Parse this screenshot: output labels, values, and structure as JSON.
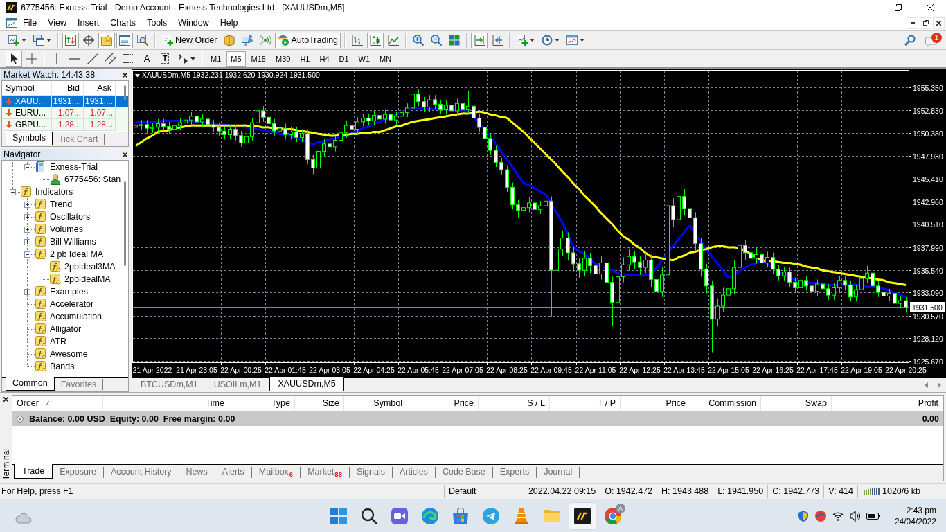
{
  "window": {
    "title": "6775456: Exness-Trial - Demo Account - Exness Technologies Ltd - [XAUUSDm,M5]"
  },
  "menu": [
    "File",
    "View",
    "Insert",
    "Charts",
    "Tools",
    "Window",
    "Help"
  ],
  "toolbar": [
    {
      "on": false
    },
    {
      "on": false
    },
    {
      "on": true
    },
    {
      "on": false
    },
    {
      "on": true
    },
    {
      "on": true
    },
    {
      "on": false
    },
    {
      "label": "New Order",
      "on": false
    },
    {
      "on": false
    },
    {
      "on": false
    },
    {
      "on": false
    },
    {
      "label": "AutoTrading",
      "on": true
    },
    {
      "on": false
    },
    {
      "on": true
    },
    {
      "on": false
    },
    {
      "on": false
    },
    {
      "on": false
    },
    {
      "on": false
    },
    {
      "on": true
    },
    {
      "on": false
    },
    {
      "on": false
    },
    {
      "on": false
    },
    {
      "on": false
    }
  ],
  "notifications": "1",
  "drawing_tools": [
    {
      "on": true
    },
    {
      "on": false
    },
    {
      "on": false
    },
    {
      "on": false
    },
    {
      "on": false
    },
    {
      "on": false
    },
    {
      "on": false
    },
    {
      "label": "A",
      "on": false
    },
    {
      "label": "T",
      "on": false
    },
    {
      "on": false
    }
  ],
  "periods": [
    {
      "label": "M1",
      "selected": false
    },
    {
      "label": "M5",
      "selected": true
    },
    {
      "label": "M15",
      "selected": false
    },
    {
      "label": "M30",
      "selected": false
    },
    {
      "label": "H1",
      "selected": false
    },
    {
      "label": "H4",
      "selected": false
    },
    {
      "label": "D1",
      "selected": false
    },
    {
      "label": "W1",
      "selected": false
    },
    {
      "label": "MN",
      "selected": false
    }
  ],
  "market_watch": {
    "title": "Market Watch: 14:43:38",
    "columns": [
      "Symbol",
      "Bid",
      "Ask"
    ],
    "rows": [
      {
        "symbol": "XAUU...",
        "bid": "1931....",
        "ask": "1931....",
        "down": true,
        "selected": true
      },
      {
        "symbol": "EURU...",
        "bid": "1.07...",
        "ask": "1.07...",
        "down": true,
        "selected": false
      },
      {
        "symbol": "GBPU...",
        "bid": "1.28...",
        "ask": "1.28...",
        "down": true,
        "selected": false
      }
    ],
    "tabs": [
      {
        "label": "Symbols",
        "selected": true
      },
      {
        "label": "Tick Chart",
        "selected": false
      }
    ]
  },
  "navigator": {
    "title": "Navigator",
    "tree": [
      {
        "children": [
          {
            "label": "Exness-Trial",
            "kind": "server",
            "expanded": true,
            "children": [
              {
                "label": "6775456: Stan",
                "kind": "account"
              }
            ]
          }
        ]
      },
      {
        "label": "Indicators",
        "kind": "function",
        "expanded": true,
        "children": [
          {
            "label": "Trend",
            "kind": "function",
            "expanded": false
          },
          {
            "label": "Oscillators",
            "kind": "function",
            "expanded": false
          },
          {
            "label": "Volumes",
            "kind": "function",
            "expanded": false
          },
          {
            "label": "Bill Williams",
            "kind": "function",
            "expanded": false
          },
          {
            "label": "2 pb Ideal MA",
            "kind": "custom",
            "expanded": true,
            "children": [
              {
                "label": "2pbIdeal3MA",
                "kind": "custom"
              },
              {
                "label": "2pbIdealMA",
                "kind": "custom"
              }
            ]
          },
          {
            "label": "Examples",
            "kind": "custom",
            "expanded": false
          },
          {
            "label": "Accelerator",
            "kind": "custom"
          },
          {
            "label": "Accumulation",
            "kind": "custom"
          },
          {
            "label": "Alligator",
            "kind": "custom"
          },
          {
            "label": "ATR",
            "kind": "custom"
          },
          {
            "label": "Awesome",
            "kind": "custom"
          },
          {
            "label": "Bands",
            "kind": "custom"
          }
        ]
      }
    ],
    "tabs": [
      {
        "label": "Common",
        "selected": true
      },
      {
        "label": "Favorites",
        "selected": false
      }
    ]
  },
  "chart": {
    "chart_data": [
      {
        "type": "candlestick",
        "title": "XAUUSDm,M5 1932.231 1932.620 1930.924 1931.500",
        "grid": true,
        "ylim": [
          1925.52,
          1957.15
        ],
        "categories": [
          null,
          null,
          null,
          "21 Apr 2022",
          null,
          null,
          null,
          null,
          null,
          null,
          null,
          "21 Apr 23:05",
          null,
          null,
          null,
          null,
          null,
          null,
          null,
          "22 Apr 00:25",
          null,
          null,
          null,
          null,
          null,
          null,
          null,
          "22 Apr 01:45",
          null,
          null,
          null,
          null,
          null,
          null,
          null,
          "22 Apr 03:05",
          null,
          null,
          null,
          null,
          null,
          null,
          null,
          "22 Apr 04:25",
          null,
          null,
          null,
          null,
          null,
          null,
          null,
          "22 Apr 05:45",
          null,
          null,
          null,
          null,
          null,
          null,
          null,
          "22 Apr 07:05",
          null,
          null,
          null,
          null,
          null,
          null,
          null,
          "22 Apr 08:25",
          null,
          null,
          null,
          null,
          null,
          null,
          null,
          "22 Apr 09:45",
          null,
          null,
          null,
          null,
          null,
          null,
          null,
          "22 Apr 11:05",
          null,
          null,
          null,
          null,
          null,
          null,
          null,
          "22 Apr 12:25",
          null,
          null,
          null,
          null,
          null,
          null,
          null,
          "22 Apr 13:45",
          null,
          null,
          null,
          null,
          null,
          null,
          null,
          "22 Apr 15:05",
          null,
          null,
          null,
          null,
          null,
          null,
          null,
          "22 Apr 16:25",
          null,
          null,
          null,
          null,
          null,
          null,
          null,
          "22 Apr 17:45",
          null,
          null,
          null,
          null,
          null,
          null,
          null,
          "22 Apr 19:05",
          null,
          null,
          null,
          null,
          null,
          null,
          null,
          "22 Apr 20:25"
        ],
        "yticks": [
          {
            "value": 1925.67,
            "label": "1925.670"
          },
          {
            "value": 1928.12,
            "label": "1928.120"
          },
          {
            "value": 1930.57,
            "label": "1930.570"
          },
          {
            "value": 1933.09,
            "label": "1933.090"
          },
          {
            "value": 1935.54,
            "label": "1935.540"
          },
          {
            "value": 1937.99,
            "label": "1937.990"
          },
          {
            "value": 1940.51,
            "label": "1940.510"
          },
          {
            "value": 1942.96,
            "label": "1942.960"
          },
          {
            "value": 1945.41,
            "label": "1945.410"
          },
          {
            "value": 1947.93,
            "label": "1947.930"
          },
          {
            "value": 1950.38,
            "label": "1950.380"
          },
          {
            "value": 1952.83,
            "label": "1952.830"
          },
          {
            "value": 1955.35,
            "label": "1955.350"
          }
        ],
        "ref_lines": [
          {
            "axis": "y",
            "value": 1931.5,
            "label": "1931.500",
            "color": "#778899"
          }
        ],
        "ohlc": [
          [
            1951.0,
            1951.7,
            1950.5,
            1951.2
          ],
          [
            1951.2,
            1951.8,
            1950.7,
            1951.3
          ],
          [
            1951.3,
            1951.8,
            1950.4,
            1950.9
          ],
          [
            1950.9,
            1951.5,
            1950.4,
            1951.0
          ],
          [
            1951.0,
            1951.9,
            1950.5,
            1951.4
          ],
          [
            1951.4,
            1951.9,
            1950.6,
            1951.1
          ],
          [
            1951.1,
            1951.6,
            1950.3,
            1950.8
          ],
          [
            1950.8,
            1951.7,
            1950.3,
            1951.2
          ],
          [
            1951.2,
            1952.0,
            1950.7,
            1951.5
          ],
          [
            1951.5,
            1952.3,
            1951.0,
            1951.8
          ],
          [
            1951.8,
            1952.7,
            1951.3,
            1952.2
          ],
          [
            1952.2,
            1952.7,
            1951.1,
            1951.6
          ],
          [
            1951.6,
            1952.4,
            1951.1,
            1951.9
          ],
          [
            1951.9,
            1952.4,
            1950.8,
            1951.3
          ],
          [
            1951.3,
            1951.8,
            1950.5,
            1951.0
          ],
          [
            1951.0,
            1951.5,
            1950.1,
            1950.6
          ],
          [
            1950.6,
            1951.1,
            1949.7,
            1950.2
          ],
          [
            1950.2,
            1951.3,
            1949.7,
            1950.8
          ],
          [
            1950.8,
            1951.3,
            1949.6,
            1950.1
          ],
          [
            1950.1,
            1950.6,
            1948.9,
            1949.3
          ],
          [
            1949.3,
            1950.5,
            1948.8,
            1950.0
          ],
          [
            1950.0,
            1952.0,
            1949.5,
            1951.5
          ],
          [
            1951.5,
            1953.4,
            1951.0,
            1952.8
          ],
          [
            1952.8,
            1953.3,
            1951.6,
            1952.1
          ],
          [
            1952.1,
            1952.6,
            1950.9,
            1951.4
          ],
          [
            1951.4,
            1951.9,
            1950.1,
            1950.6
          ],
          [
            1950.6,
            1951.4,
            1950.1,
            1950.9
          ],
          [
            1950.9,
            1951.4,
            1949.7,
            1950.2
          ],
          [
            1950.2,
            1951.0,
            1949.7,
            1950.5
          ],
          [
            1950.5,
            1951.0,
            1949.4,
            1949.9
          ],
          [
            1949.9,
            1950.8,
            1949.4,
            1950.3
          ],
          [
            1950.3,
            1950.8,
            1947.0,
            1947.5
          ],
          [
            1947.5,
            1948.0,
            1945.9,
            1946.6
          ],
          [
            1946.6,
            1948.9,
            1946.1,
            1948.4
          ],
          [
            1948.4,
            1949.7,
            1947.9,
            1949.2
          ],
          [
            1949.2,
            1949.7,
            1948.4,
            1948.9
          ],
          [
            1948.9,
            1950.1,
            1948.4,
            1949.6
          ],
          [
            1949.6,
            1950.9,
            1949.1,
            1950.4
          ],
          [
            1950.4,
            1951.7,
            1949.9,
            1951.2
          ],
          [
            1951.2,
            1951.7,
            1950.3,
            1950.8
          ],
          [
            1950.8,
            1952.1,
            1950.3,
            1951.6
          ],
          [
            1951.6,
            1952.5,
            1951.1,
            1952.0
          ],
          [
            1952.0,
            1952.5,
            1951.2,
            1951.7
          ],
          [
            1951.7,
            1952.8,
            1951.2,
            1952.3
          ],
          [
            1952.3,
            1952.8,
            1951.4,
            1951.9
          ],
          [
            1951.9,
            1952.9,
            1951.4,
            1952.4
          ],
          [
            1952.4,
            1952.9,
            1951.3,
            1951.8
          ],
          [
            1951.8,
            1952.7,
            1951.3,
            1952.2
          ],
          [
            1952.2,
            1953.1,
            1951.7,
            1952.6
          ],
          [
            1952.6,
            1953.6,
            1952.1,
            1953.1
          ],
          [
            1953.1,
            1955.6,
            1952.6,
            1954.6
          ],
          [
            1954.6,
            1955.1,
            1953.3,
            1953.8
          ],
          [
            1953.8,
            1954.3,
            1952.7,
            1953.2
          ],
          [
            1953.2,
            1954.5,
            1952.7,
            1954.0
          ],
          [
            1954.0,
            1954.5,
            1953.0,
            1953.5
          ],
          [
            1953.5,
            1954.0,
            1952.4,
            1952.9
          ],
          [
            1952.9,
            1953.9,
            1952.4,
            1953.4
          ],
          [
            1953.4,
            1953.9,
            1952.3,
            1952.8
          ],
          [
            1952.8,
            1954.1,
            1952.3,
            1953.6
          ],
          [
            1953.6,
            1954.1,
            1952.4,
            1952.9
          ],
          [
            1952.9,
            1954.9,
            1952.4,
            1953.3
          ],
          [
            1953.3,
            1953.8,
            1951.5,
            1952.0
          ],
          [
            1952.0,
            1952.5,
            1950.5,
            1951.0
          ],
          [
            1951.0,
            1951.5,
            1949.3,
            1949.8
          ],
          [
            1949.8,
            1950.3,
            1948.0,
            1948.5
          ],
          [
            1948.5,
            1949.0,
            1946.7,
            1947.2
          ],
          [
            1947.2,
            1947.7,
            1945.9,
            1946.4
          ],
          [
            1946.4,
            1946.9,
            1944.0,
            1944.5
          ],
          [
            1944.5,
            1945.0,
            1942.1,
            1942.6
          ],
          [
            1942.6,
            1943.1,
            1941.2,
            1942.0
          ],
          [
            1942.0,
            1942.8,
            1941.5,
            1942.3
          ],
          [
            1942.3,
            1943.4,
            1941.8,
            1942.8
          ],
          [
            1942.8,
            1943.3,
            1941.6,
            1942.1
          ],
          [
            1942.1,
            1943.0,
            1941.6,
            1942.5
          ],
          [
            1942.5,
            1943.7,
            1942.0,
            1943.0
          ],
          [
            1943.0,
            1943.5,
            1930.5,
            1935.5
          ],
          [
            1935.5,
            1938.6,
            1934.7,
            1937.8
          ],
          [
            1937.8,
            1939.8,
            1937.0,
            1939.0
          ],
          [
            1939.0,
            1939.6,
            1936.6,
            1937.4
          ],
          [
            1937.4,
            1938.0,
            1935.4,
            1936.2
          ],
          [
            1936.2,
            1936.8,
            1934.7,
            1935.5
          ],
          [
            1935.5,
            1937.6,
            1934.9,
            1936.8
          ],
          [
            1936.8,
            1937.4,
            1935.2,
            1936.0
          ],
          [
            1936.0,
            1936.6,
            1934.3,
            1935.1
          ],
          [
            1935.1,
            1937.1,
            1934.5,
            1936.3
          ],
          [
            1936.3,
            1936.9,
            1933.4,
            1934.2
          ],
          [
            1934.2,
            1934.8,
            1929.4,
            1932.0
          ],
          [
            1932.0,
            1935.6,
            1931.4,
            1934.8
          ],
          [
            1934.8,
            1936.9,
            1934.2,
            1936.1
          ],
          [
            1936.1,
            1937.8,
            1935.5,
            1937.0
          ],
          [
            1937.0,
            1937.6,
            1935.6,
            1936.4
          ],
          [
            1936.4,
            1937.0,
            1935.0,
            1935.8
          ],
          [
            1935.8,
            1937.4,
            1935.2,
            1936.6
          ],
          [
            1936.6,
            1937.2,
            1933.7,
            1934.5
          ],
          [
            1934.5,
            1935.1,
            1932.4,
            1933.2
          ],
          [
            1933.2,
            1935.8,
            1932.6,
            1935.0
          ],
          [
            1935.0,
            1945.8,
            1934.4,
            1942.5
          ],
          [
            1942.5,
            1943.3,
            1940.2,
            1941.0
          ],
          [
            1941.0,
            1944.8,
            1940.4,
            1943.5
          ],
          [
            1943.5,
            1944.3,
            1941.4,
            1942.2
          ],
          [
            1942.2,
            1942.8,
            1940.4,
            1941.2
          ],
          [
            1941.2,
            1941.8,
            1937.6,
            1938.4
          ],
          [
            1938.4,
            1939.0,
            1934.8,
            1935.6
          ],
          [
            1935.6,
            1936.2,
            1933.0,
            1933.8
          ],
          [
            1933.8,
            1934.4,
            1926.6,
            1930.2
          ],
          [
            1930.2,
            1932.4,
            1929.4,
            1931.6
          ],
          [
            1931.6,
            1933.6,
            1931.0,
            1932.8
          ],
          [
            1932.8,
            1934.3,
            1932.2,
            1933.5
          ],
          [
            1933.5,
            1936.6,
            1932.9,
            1935.8
          ],
          [
            1935.8,
            1940.6,
            1935.2,
            1938.2
          ],
          [
            1938.2,
            1938.8,
            1936.6,
            1937.4
          ],
          [
            1937.4,
            1938.0,
            1936.2,
            1936.8
          ],
          [
            1936.8,
            1938.0,
            1936.2,
            1937.2
          ],
          [
            1937.2,
            1937.8,
            1935.7,
            1936.3
          ],
          [
            1936.3,
            1937.5,
            1935.8,
            1936.9
          ],
          [
            1936.9,
            1937.4,
            1935.1,
            1935.6
          ],
          [
            1935.6,
            1936.1,
            1934.4,
            1934.9
          ],
          [
            1934.9,
            1935.8,
            1934.4,
            1935.3
          ],
          [
            1935.3,
            1935.8,
            1933.7,
            1934.2
          ],
          [
            1934.2,
            1934.7,
            1933.1,
            1933.6
          ],
          [
            1933.6,
            1934.9,
            1933.1,
            1934.4
          ],
          [
            1934.4,
            1934.9,
            1933.3,
            1933.8
          ],
          [
            1933.8,
            1934.3,
            1932.7,
            1933.2
          ],
          [
            1933.2,
            1934.5,
            1932.7,
            1934.0
          ],
          [
            1934.0,
            1934.5,
            1933.0,
            1933.5
          ],
          [
            1933.5,
            1934.0,
            1932.3,
            1932.8
          ],
          [
            1932.8,
            1934.1,
            1932.3,
            1933.6
          ],
          [
            1933.6,
            1934.9,
            1933.1,
            1934.4
          ],
          [
            1934.4,
            1934.9,
            1933.4,
            1933.9
          ],
          [
            1933.9,
            1934.4,
            1932.1,
            1932.6
          ],
          [
            1932.6,
            1933.9,
            1932.1,
            1933.4
          ],
          [
            1933.4,
            1935.1,
            1932.9,
            1934.6
          ],
          [
            1934.6,
            1936.0,
            1934.1,
            1935.2
          ],
          [
            1935.2,
            1935.7,
            1933.3,
            1933.8
          ],
          [
            1933.8,
            1934.3,
            1932.6,
            1933.1
          ],
          [
            1933.1,
            1933.6,
            1932.2,
            1932.7
          ],
          [
            1932.7,
            1933.5,
            1932.2,
            1933.0
          ],
          [
            1933.0,
            1933.5,
            1931.4,
            1931.9
          ],
          [
            1931.9,
            1932.7,
            1931.4,
            1932.2
          ],
          [
            1932.2,
            1932.6,
            1930.9,
            1931.5
          ]
        ],
        "series": [
          {
            "type": "line",
            "color": "#0000ff",
            "values": [
              1951.6,
              1951.6,
              1951.6,
              1951.6,
              1951.6,
              1951.7,
              1951.7,
              1951.7,
              1951.7,
              1951.7,
              1951.7,
              1951.6,
              1951.6,
              1951.5,
              1951.4,
              1951.3,
              1951.3,
              1951.2,
              1951.1,
              1951.1,
              1951.0,
              1950.9,
              1950.8,
              1950.7,
              1950.6,
              1950.4,
              1950.3,
              1950.2,
              1950.1,
              1949.9,
              1949.6,
              1949.4,
              1949.2,
              1949.4,
              1949.5,
              1949.7,
              1949.8,
              1950.0,
              1950.1,
              1950.4,
              1950.6,
              1950.9,
              1951.1,
              1951.4,
              1951.6,
              1951.9,
              1952.1,
              1952.4,
              1952.6,
              1952.9,
              1953.1,
              1953.1,
              1953.0,
              1953.0,
              1953.0,
              1953.0,
              1952.9,
              1952.9,
              1952.8,
              1952.8,
              1952.7,
              1952.1,
              1951.4,
              1950.8,
              1950.0,
              1949.2,
              1948.3,
              1947.5,
              1946.7,
              1945.8,
              1945.0,
              1944.7,
              1944.4,
              1944.0,
              1943.7,
              1942.7,
              1941.7,
              1940.7,
              1939.4,
              1938.1,
              1937.6,
              1937.2,
              1936.7,
              1936.2,
              1936.0,
              1935.7,
              1935.5,
              1935.2,
              1935.0,
              1935.0,
              1935.0,
              1935.0,
              1935.0,
              1935.0,
              1935.8,
              1936.6,
              1937.4,
              1938.1,
              1938.9,
              1939.6,
              1940.3,
              1939.4,
              1938.6,
              1937.7,
              1937.0,
              1936.2,
              1935.5,
              1934.7,
              1935.1,
              1935.4,
              1935.8,
              1936.1,
              1936.3,
              1936.6,
              1936.2,
              1935.8,
              1935.4,
              1935.0,
              1934.8,
              1934.5,
              1934.3,
              1934.2,
              1934.1,
              1934.1,
              1934.0,
              1933.9,
              1933.9,
              1933.9,
              1933.9,
              1933.9,
              1933.9,
              1933.8,
              1933.7,
              1933.7,
              1933.6,
              1933.5,
              1933.3,
              1933.0,
              1932.8,
              1932.6
            ]
          },
          {
            "type": "line",
            "color": "#ffff00",
            "values": [
              1949.0,
              1949.4,
              1949.8,
              1950.1,
              1950.5,
              1950.6,
              1950.7,
              1950.9,
              1951.0,
              1951.1,
              1951.2,
              1951.2,
              1951.2,
              1951.2,
              1951.2,
              1951.2,
              1951.2,
              1951.2,
              1951.2,
              1951.2,
              1951.2,
              1951.1,
              1951.1,
              1951.0,
              1951.0,
              1950.9,
              1950.9,
              1950.8,
              1950.8,
              1950.7,
              1950.6,
              1950.5,
              1950.4,
              1950.3,
              1950.2,
              1950.1,
              1950.1,
              1950.2,
              1950.2,
              1950.3,
              1950.3,
              1950.4,
              1950.4,
              1950.5,
              1950.5,
              1950.7,
              1950.9,
              1951.1,
              1951.2,
              1951.4,
              1951.6,
              1951.7,
              1951.8,
              1951.9,
              1952.0,
              1952.1,
              1952.2,
              1952.3,
              1952.4,
              1952.5,
              1952.5,
              1952.6,
              1952.7,
              1952.6,
              1952.4,
              1952.3,
              1952.1,
              1952.0,
              1951.5,
              1951.0,
              1950.5,
              1949.9,
              1949.3,
              1948.7,
              1948.1,
              1947.5,
              1946.9,
              1946.2,
              1945.6,
              1944.9,
              1944.3,
              1943.6,
              1943.0,
              1942.4,
              1941.7,
              1941.1,
              1940.5,
              1939.8,
              1939.2,
              1938.8,
              1938.3,
              1937.9,
              1937.4,
              1937.0,
              1936.9,
              1936.8,
              1936.7,
              1936.6,
              1936.9,
              1937.1,
              1937.4,
              1937.5,
              1937.7,
              1937.8,
              1938.0,
              1938.1,
              1938.1,
              1938.0,
              1938.0,
              1937.9,
              1937.6,
              1937.3,
              1936.9,
              1936.6,
              1936.5,
              1936.5,
              1936.4,
              1936.3,
              1936.3,
              1936.2,
              1936.1,
              1935.9,
              1935.8,
              1935.7,
              1935.5,
              1935.4,
              1935.3,
              1935.2,
              1935.1,
              1935.0,
              1934.9,
              1934.8,
              1934.7,
              1934.6,
              1934.5,
              1934.4,
              1934.2,
              1934.1,
              1934.0,
              1933.9
            ]
          }
        ]
      }
    ]
  },
  "chart_tabs": [
    {
      "label": "BTCUSDm,M1",
      "selected": false
    },
    {
      "label": "USOILm,M1",
      "selected": false
    },
    {
      "label": "XAUUSDm,M5",
      "selected": true
    }
  ],
  "terminal": {
    "title": "Terminal",
    "columns": [
      {
        "label": "Order",
        "sorted": true
      },
      {
        "label": "Time",
        "sorted": false
      },
      {
        "label": "Type",
        "sorted": false
      },
      {
        "label": "Size",
        "sorted": false
      },
      {
        "label": "Symbol",
        "sorted": false
      },
      {
        "label": "Price",
        "sorted": false
      },
      {
        "label": "S / L",
        "sorted": false
      },
      {
        "label": "T / P",
        "sorted": false
      },
      {
        "label": "Price",
        "sorted": false
      },
      {
        "label": "Commission",
        "sorted": false
      },
      {
        "label": "Swap",
        "sorted": false
      },
      {
        "label": "Profit",
        "sorted": false
      }
    ],
    "summary": "Balance: 0.00 USD  Equity: 0.00  Free margin: 0.00",
    "profit": "0.00",
    "tabs": [
      {
        "label": "Trade",
        "selected": true
      },
      {
        "label": "Exposure",
        "selected": false
      },
      {
        "label": "Account History",
        "selected": false
      },
      {
        "label": "News",
        "selected": false
      },
      {
        "label": "Alerts",
        "selected": false
      },
      {
        "label": "Mailbox",
        "badge": "6",
        "selected": false
      },
      {
        "label": "Market",
        "badge": "88",
        "selected": false
      },
      {
        "label": "Signals",
        "selected": false
      },
      {
        "label": "Articles",
        "selected": false
      },
      {
        "label": "Code Base",
        "selected": false
      },
      {
        "label": "Experts",
        "selected": false
      },
      {
        "label": "Journal",
        "selected": false
      }
    ]
  },
  "status_bar": {
    "help": "For Help, press F1",
    "profile": "Default",
    "time": "2022.04.22 09:15",
    "open": "O: 1942.472",
    "high": "H: 1943.488",
    "low": "L: 1941.950",
    "close": "C: 1942.773",
    "volume": "V: 414",
    "traffic": "1020/6 kb"
  },
  "taskbar": {
    "apps": [
      {
        "active": false
      },
      {
        "active": false
      },
      {
        "active": false
      },
      {
        "active": false
      },
      {
        "active": false
      },
      {
        "active": false
      },
      {
        "active": false
      },
      {
        "active": false
      },
      {
        "active": true
      },
      {
        "active": false,
        "badge": "A"
      }
    ],
    "time": "2:43 pm",
    "date": "24/04/2022"
  }
}
